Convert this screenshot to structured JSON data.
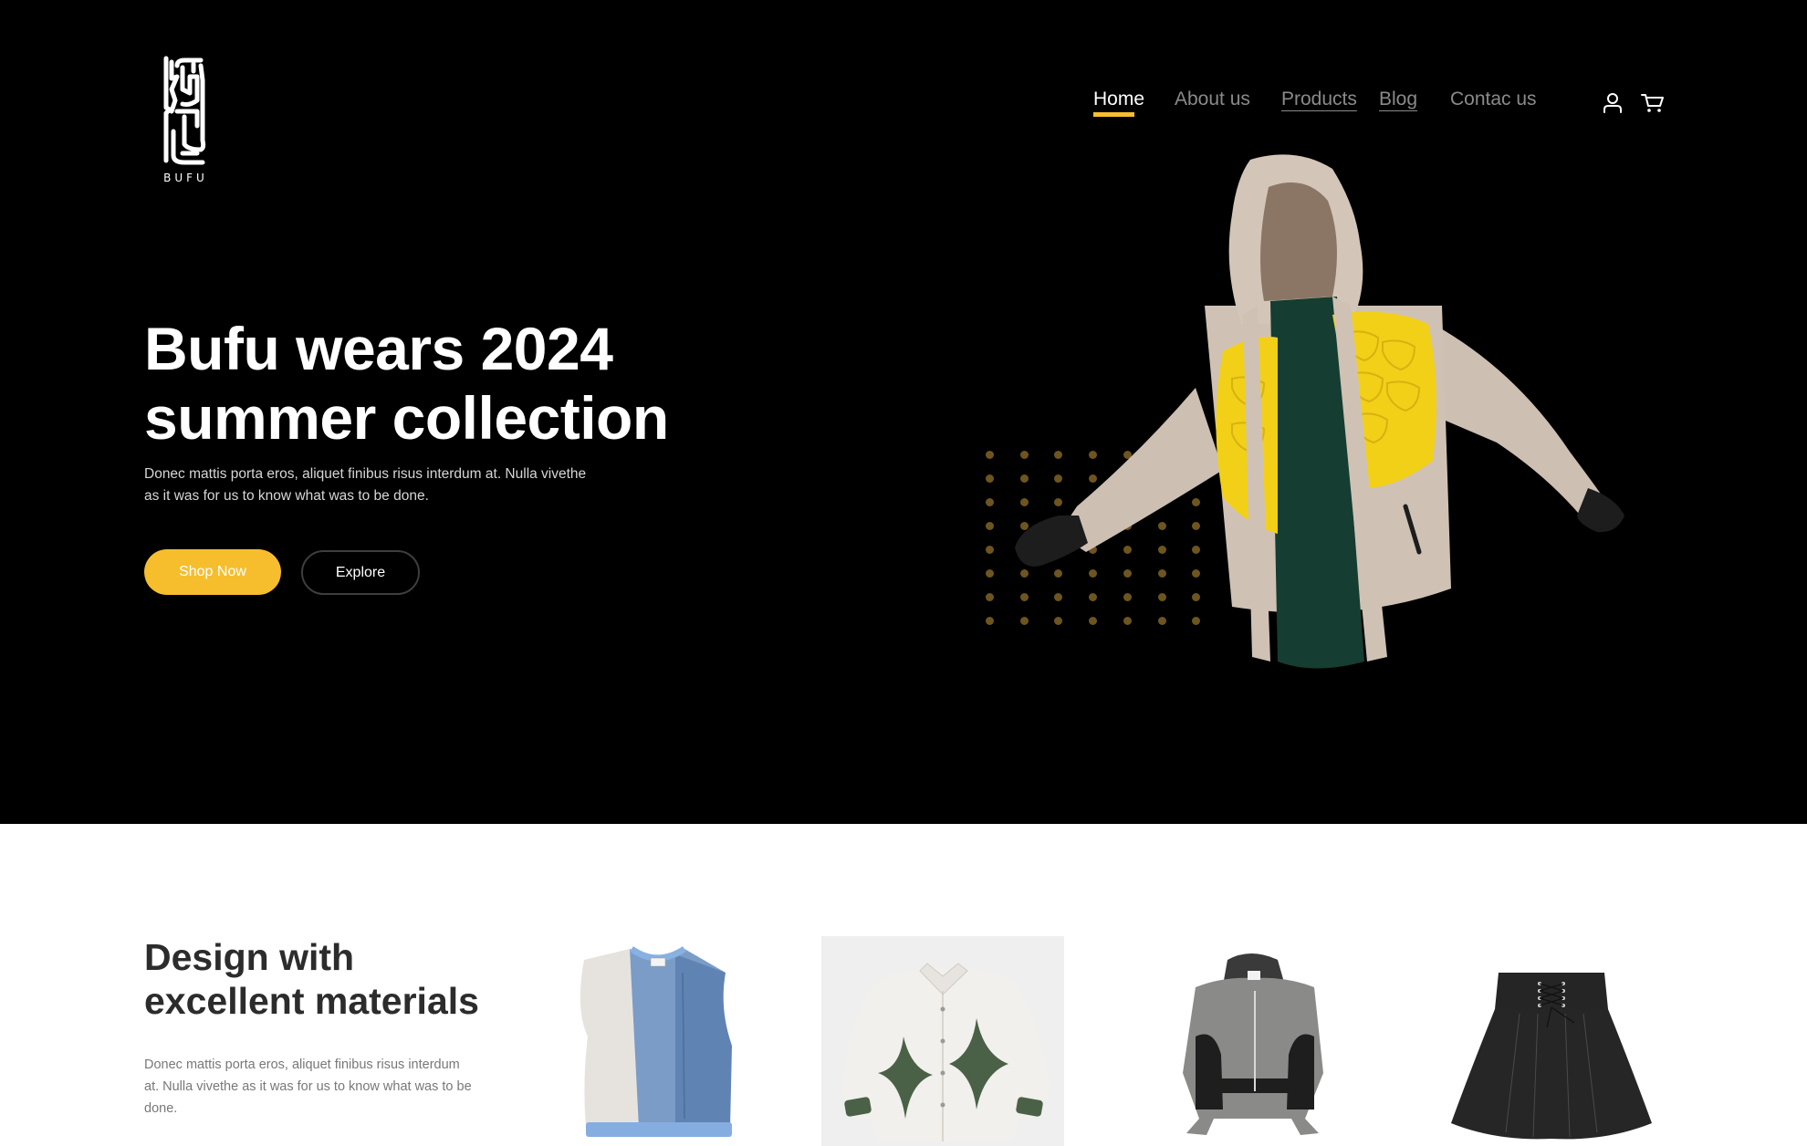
{
  "brand": {
    "name": "BUFU",
    "logo_icon": "bufu-glyph-logo"
  },
  "nav": {
    "items": [
      {
        "label": "Home",
        "active": true
      },
      {
        "label": "About us",
        "active": false
      },
      {
        "label": "Products",
        "active": false
      },
      {
        "label": "Blog",
        "active": false
      },
      {
        "label": "Contac us",
        "active": false
      }
    ],
    "icons": {
      "account": "user-icon",
      "cart": "cart-icon"
    }
  },
  "hero": {
    "title_line1": "Bufu wears 2024",
    "title_line2": "summer collection",
    "description": "Donec mattis porta eros, aliquet finibus risus interdum at. Nulla vivethe as it was for us to know what was to be done.",
    "primary_button": "Shop Now",
    "secondary_button": "Explore",
    "image": "hooded jacket with yellow padded panels"
  },
  "materials": {
    "title_line1": "Design with",
    "title_line2": "excellent materials",
    "description": "Donec mattis porta eros, aliquet finibus risus interdum at. Nulla vivethe as it was for us to know what was to be done.",
    "products": [
      {
        "name": "Patchwork denim vest"
      },
      {
        "name": "White jacket with green star panels"
      },
      {
        "name": "Gray cropped hooded bomber jacket"
      },
      {
        "name": "Black lace-up pleated skirt"
      }
    ]
  },
  "colors": {
    "accent": "#f6be2c",
    "hero_bg": "#000000",
    "nav_inactive": "#8a8a8a",
    "dot": "#6e5520",
    "heading_dark": "#2c2c2c"
  }
}
